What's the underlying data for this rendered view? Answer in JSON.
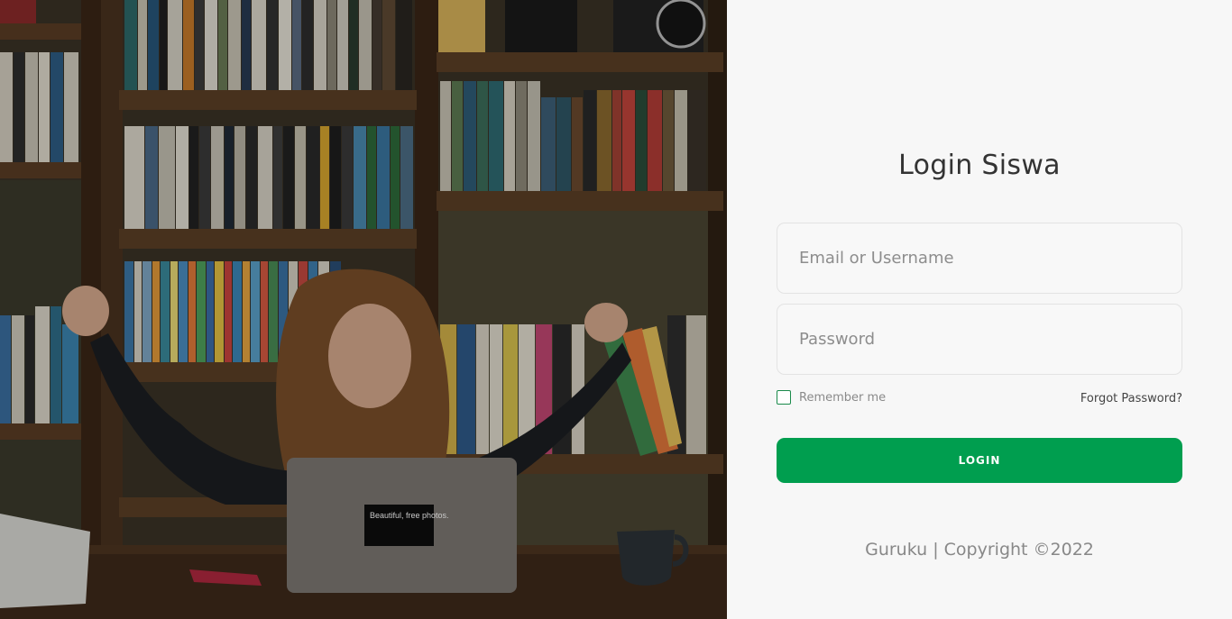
{
  "login": {
    "title": "Login Siswa",
    "email_placeholder": "Email or Username",
    "password_placeholder": "Password",
    "remember_label": "Remember me",
    "forgot_label": "Forgot Password?",
    "button_label": "LOGIN"
  },
  "footer": {
    "text": "Guruku | Copyright ©2022"
  },
  "photo": {
    "laptop_sticker": "Beautiful, free photos."
  },
  "colors": {
    "accent": "#009e4f",
    "panel_bg": "#f7f7f7"
  }
}
